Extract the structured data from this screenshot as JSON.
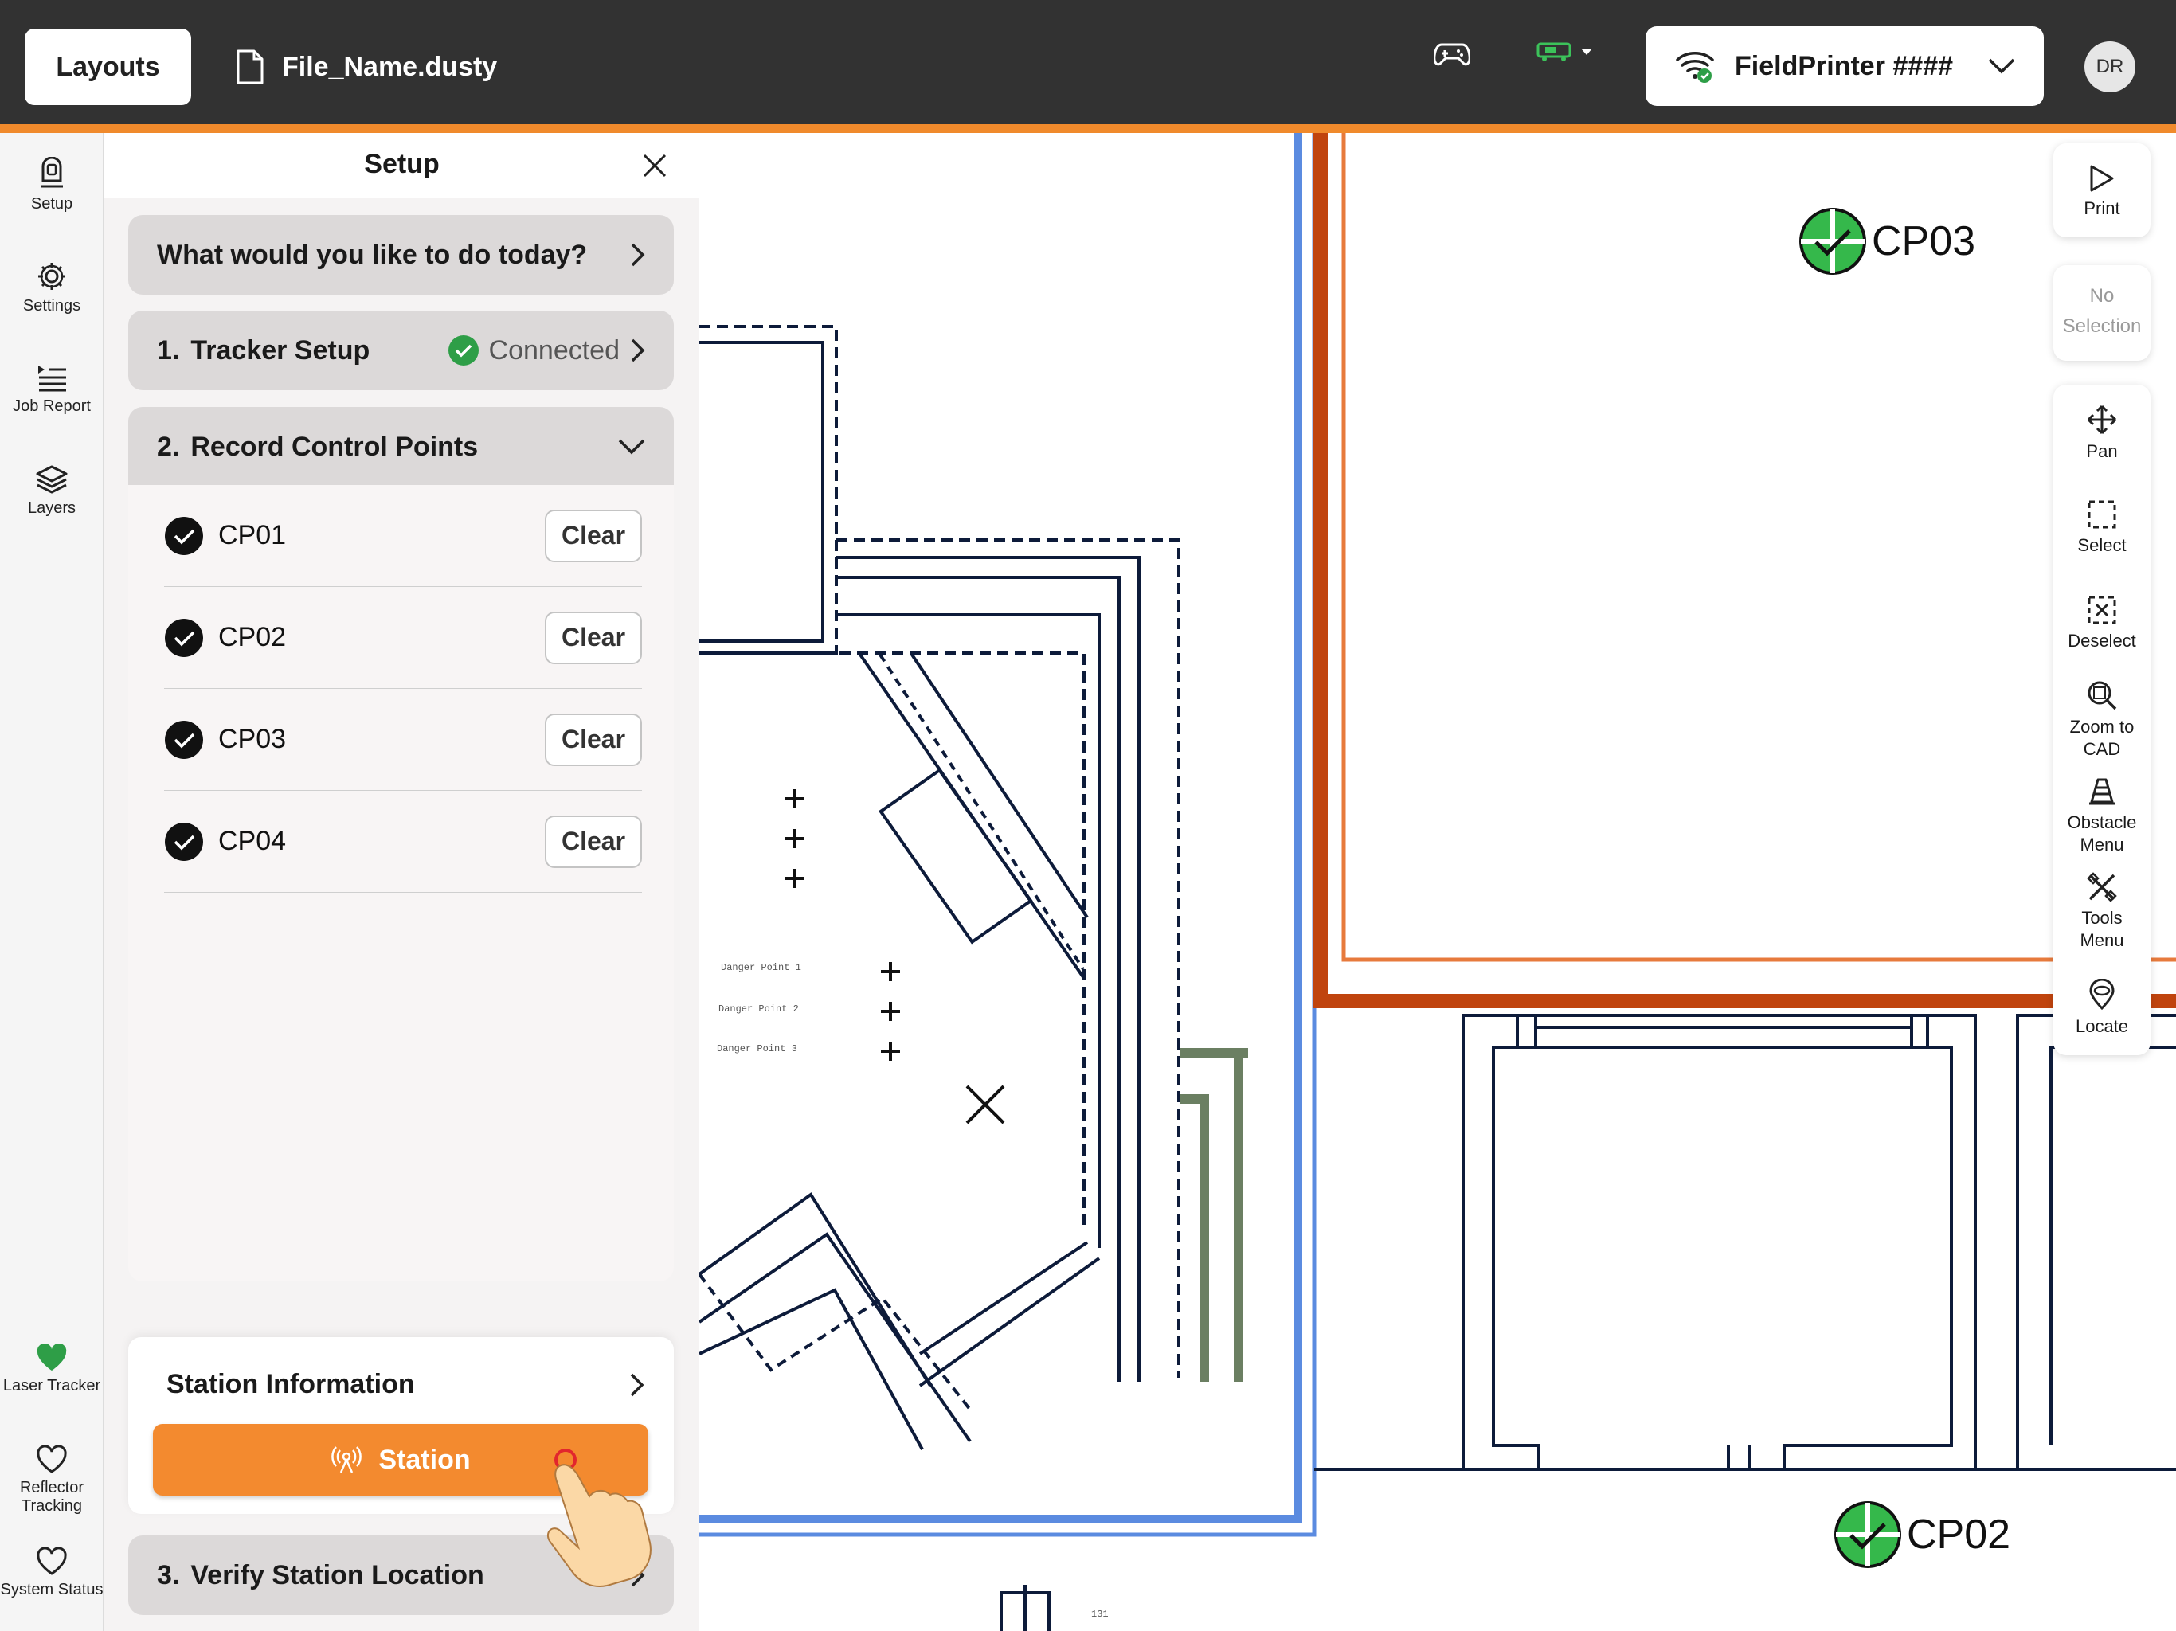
{
  "topbar": {
    "layouts_label": "Layouts",
    "file_name": "File_Name.dusty",
    "printer_name": "FieldPrinter ####",
    "avatar_initials": "DR"
  },
  "left_rail": {
    "items": [
      {
        "label": "Setup",
        "icon": "tracker-icon"
      },
      {
        "label": "Settings",
        "icon": "gear-icon"
      },
      {
        "label": "Job Report",
        "icon": "list-icon"
      },
      {
        "label": "Layers",
        "icon": "layers-icon"
      }
    ],
    "status_items": [
      {
        "label": "Laser Tracker",
        "icon": "heart-icon",
        "state": "filled",
        "color": "#2e9e47"
      },
      {
        "label": "Reflector Tracking",
        "icon": "heart-icon",
        "state": "outline"
      },
      {
        "label": "System Status",
        "icon": "heart-icon",
        "state": "outline"
      }
    ]
  },
  "setup_panel": {
    "title": "Setup",
    "prompt": "What would you like to do today?",
    "step1": {
      "number": "1.",
      "label": "Tracker Setup",
      "status": "Connected"
    },
    "step2": {
      "number": "2.",
      "label": "Record Control Points"
    },
    "control_points": [
      {
        "name": "CP01",
        "action": "Clear"
      },
      {
        "name": "CP02",
        "action": "Clear"
      },
      {
        "name": "CP03",
        "action": "Clear"
      },
      {
        "name": "CP04",
        "action": "Clear"
      }
    ],
    "station_info_label": "Station Information",
    "station_button_label": "Station",
    "step3": {
      "number": "3.",
      "label": "Verify Station Location"
    }
  },
  "right_toolbar": {
    "print_label": "Print",
    "no_selection_line1": "No",
    "no_selection_line2": "Selection",
    "tools": [
      {
        "label": "Pan",
        "icon": "pan-icon"
      },
      {
        "label": "Select",
        "icon": "select-icon"
      },
      {
        "label": "Deselect",
        "icon": "deselect-icon"
      },
      {
        "label": "Zoom to CAD",
        "icon": "zoom-icon"
      },
      {
        "label": "Obstacle Menu",
        "icon": "cone-icon"
      },
      {
        "label": "Tools Menu",
        "icon": "tools-icon"
      },
      {
        "label": "Locate",
        "icon": "locate-icon"
      }
    ]
  },
  "canvas": {
    "cp_labels": [
      "CP03",
      "CP02"
    ],
    "annotations": [
      "Danger Point 1",
      "Danger Point 2",
      "Danger Point 3",
      "131"
    ]
  },
  "colors": {
    "accent_orange": "#f08a2c",
    "topbar": "#323232",
    "connected_green": "#2e9e47",
    "cad_blue": "#5b8be0",
    "cad_orange": "#c0440e"
  }
}
